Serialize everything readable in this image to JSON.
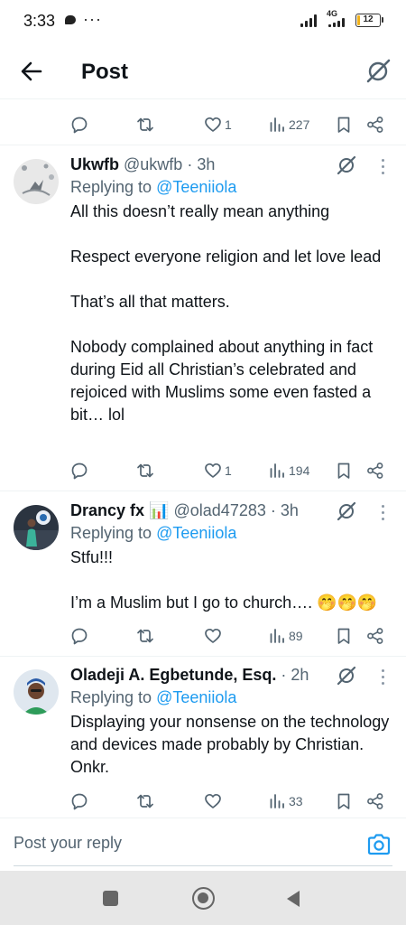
{
  "status_bar": {
    "time": "3:33",
    "network": "4G",
    "battery_level": "12"
  },
  "header": {
    "title": "Post"
  },
  "top_actions": {
    "likes": "1",
    "views": "227"
  },
  "tweets": [
    {
      "name": "Ukwfb",
      "handle": "@ukwfb",
      "time": "· 3h",
      "replying_prefix": "Replying to",
      "replying_to": "@Teeniiola",
      "body": [
        "All this doesn’t really mean anything",
        "Respect everyone religion and let love lead",
        "That’s all that matters.",
        "Nobody complained about anything in fact during Eid all Christian’s celebrated and rejoiced with Muslims some even fasted a bit… lol"
      ],
      "likes": "1",
      "views": "194"
    },
    {
      "name": "Drancy fx",
      "name_emoji": "📊",
      "handle": "@olad47283",
      "time": "· 3h",
      "replying_prefix": "Replying to",
      "replying_to": "@Teeniiola",
      "body": [
        "Stfu!!!",
        "I’m a Muslim but I go to church…. 🤭🤭🤭"
      ],
      "likes": "",
      "views": "89"
    },
    {
      "name": "Oladeji A. Egbetunde, Esq.",
      "handle": "",
      "time": "· 2h",
      "replying_prefix": "Replying to",
      "replying_to": "@Teeniiola",
      "body": [
        "Displaying your nonsense on the technology and devices made probably by Christian.  Onkr."
      ],
      "likes": "",
      "views": "33"
    }
  ],
  "reply_bar": {
    "placeholder": "Post your reply"
  },
  "colors": {
    "accent": "#1d9bf0",
    "secondary_text": "#536471",
    "primary_text": "#0f1419",
    "divider": "#eff3f4",
    "battery": "#f1b21b"
  },
  "icons": [
    "back-arrow-icon",
    "grok-icon",
    "reply-icon",
    "retweet-icon",
    "heart-icon",
    "views-icon",
    "bookmark-icon",
    "share-icon",
    "more-icon",
    "camera-icon"
  ]
}
